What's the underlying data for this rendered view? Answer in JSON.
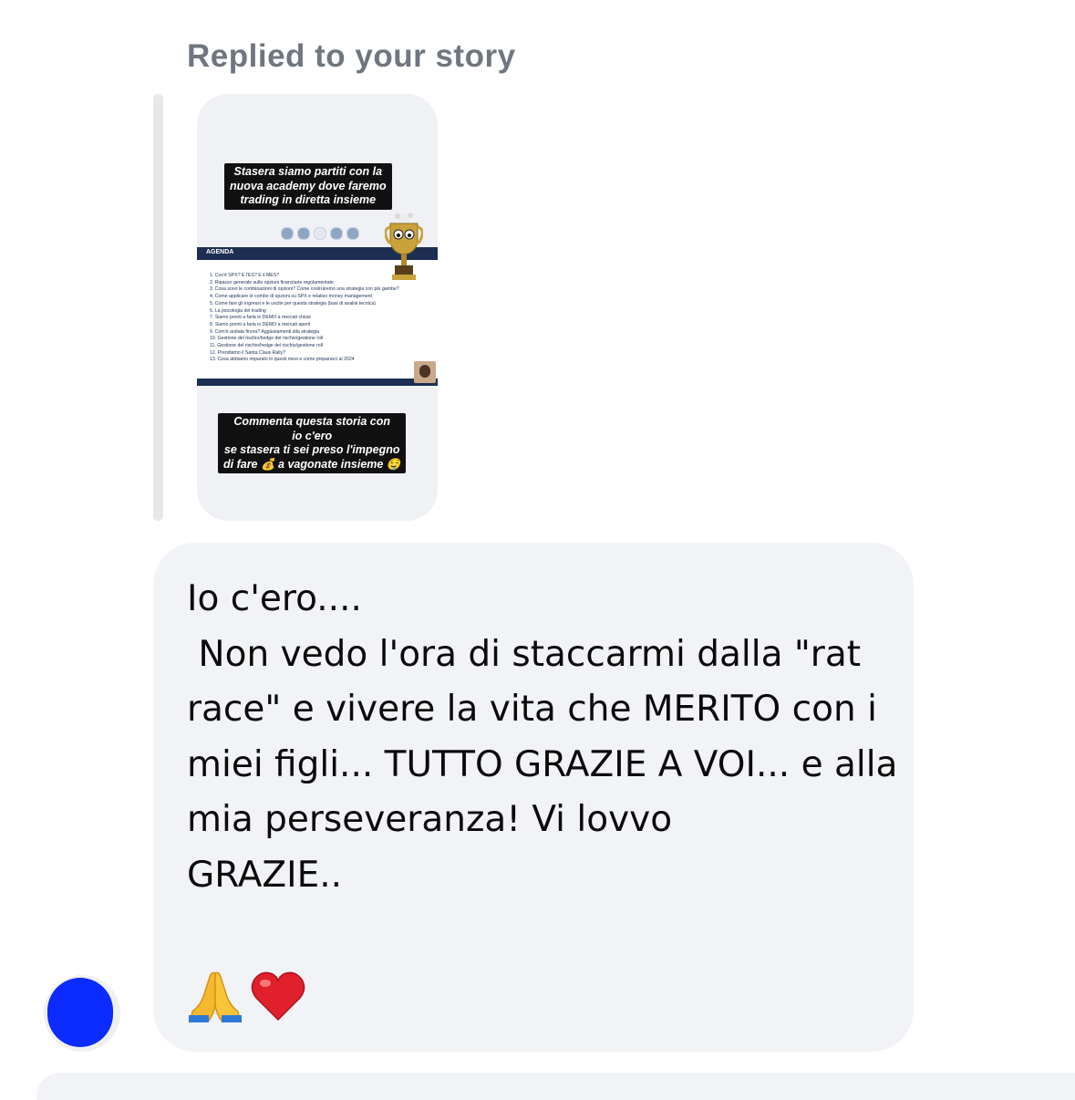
{
  "reply": {
    "label": "Replied to your story"
  },
  "story": {
    "caption_top": "Stasera siamo partiti con la\nnuova academy dove faremo\ntrading in diretta insieme",
    "slide_title": "AGENDA",
    "agenda": [
      "1.  Cos'è SPX? E l'ES? E il MES?",
      "2.  Ripasso generale sulle opzioni finanziarie regolamentate",
      "3.  Cosa sono le combinazioni di opzioni? Come costruiremo una strategia con più gambe?",
      "4.  Come applicare le combo di opzioni su SPX e relativo money management",
      "5.  Come fare gli ingressi e le uscite per questa strategia (basi di analisi tecnica)",
      "6.  La psicologia del trading",
      "7.  Siamo pronti a farla in DEMO a mercati chiusi",
      "8.  Siamo pronti a farla in DEMO a mercati aperti",
      "9.  Com'è andata finora? Aggiustamenti alla strategia",
      "10. Gestione del rischio/hedge del rischio/gestione roll",
      "11. Gestione del rischio/hedge del rischio/gestione roll",
      "12. Prendiamo il Santa Claus Rally?",
      "13. Cosa abbiamo imparato in questi mesi e come prepararci al 2024"
    ],
    "caption_bottom": "Commenta questa storia con\nio c'ero\nse stasera ti sei preso l'impegno\ndi fare 💰 a vagonate insieme 🤤"
  },
  "message": {
    "text": "Io c'ero....\n Non vedo l'ora di staccarmi dalla \"rat race\" e vivere la vita che MERITO con i miei figli... TUTTO GRAZIE A VOI... e alla mia perseveranza! Vi lovvo\nGRAZIE..",
    "emojis": [
      "🙏",
      "❤️"
    ]
  }
}
